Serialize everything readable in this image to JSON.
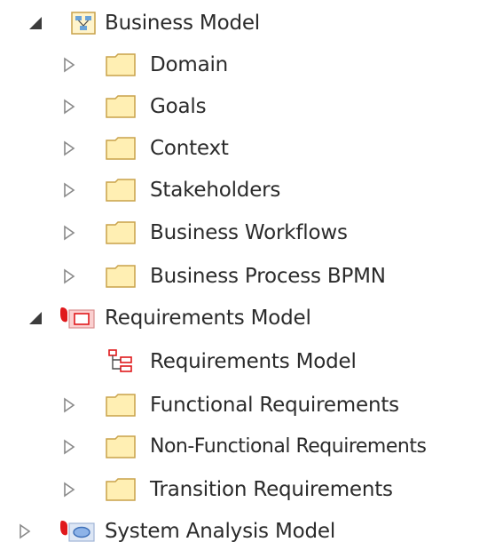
{
  "tree": {
    "business_model": {
      "label": "Business Model",
      "expanded": true,
      "icon": "business-model-package-icon",
      "children": [
        {
          "label": "Domain",
          "icon": "folder-icon"
        },
        {
          "label": "Goals",
          "icon": "folder-icon"
        },
        {
          "label": "Context",
          "icon": "folder-icon"
        },
        {
          "label": "Stakeholders",
          "icon": "folder-icon"
        },
        {
          "label": "Business Workflows",
          "icon": "folder-icon"
        },
        {
          "label": "Business Process BPMN",
          "icon": "folder-icon"
        }
      ]
    },
    "requirements_model": {
      "label": "Requirements Model",
      "expanded": true,
      "icon": "requirements-package-icon",
      "children": [
        {
          "label": "Requirements Model",
          "icon": "diagram-icon"
        },
        {
          "label": "Functional Requirements",
          "icon": "folder-icon"
        },
        {
          "label": "Non-Functional Requirements",
          "icon": "folder-icon"
        },
        {
          "label": "Transition Requirements",
          "icon": "folder-icon"
        }
      ]
    },
    "system_analysis_model": {
      "label": "System Analysis Model",
      "expanded": false,
      "icon": "system-analysis-package-icon"
    }
  },
  "colors": {
    "folder_fill": "#FFEFB3",
    "folder_stroke": "#C9A24A",
    "expanded_triangle": "#3c3c3c",
    "collapsed_triangle": "#8a8a8a",
    "package_red": "#E0191C",
    "text": "#2b2b2b"
  }
}
